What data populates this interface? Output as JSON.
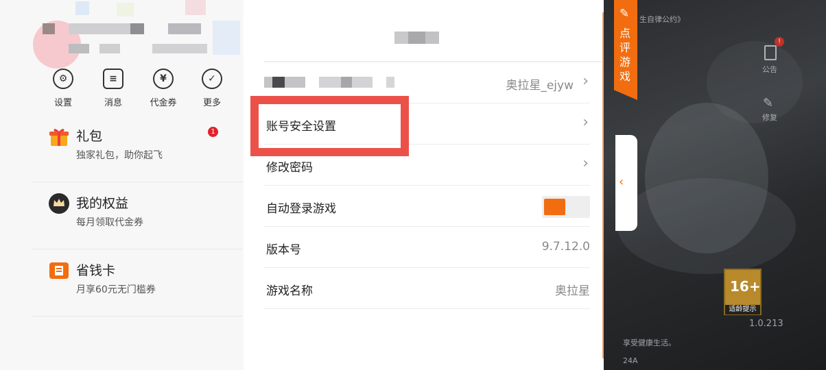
{
  "quick_actions": [
    {
      "label": "设置",
      "icon": "gear-icon",
      "glyph": "⚙"
    },
    {
      "label": "消息",
      "icon": "message-icon",
      "glyph": "≡"
    },
    {
      "label": "代金券",
      "icon": "voucher-icon",
      "glyph": "¥"
    },
    {
      "label": "更多",
      "icon": "more-icon",
      "glyph": "✓"
    }
  ],
  "cards": [
    {
      "title": "礼包",
      "subtitle": "独家礼包，助你起飞",
      "icon": "gift-icon",
      "badge": "1"
    },
    {
      "title": "我的权益",
      "subtitle": "每月领取代金券",
      "icon": "crown-icon"
    },
    {
      "title": "省钱卡",
      "subtitle": "月享60元无门槛券",
      "icon": "savings-card-icon"
    }
  ],
  "settings": {
    "account_value": "奥拉星_ejyw",
    "rows": [
      {
        "label": "账号安全设置"
      },
      {
        "label": "修改密码"
      },
      {
        "label": "自动登录游戏",
        "toggle": true
      },
      {
        "label": "版本号",
        "value": "9.7.12.0"
      },
      {
        "label": "游戏名称",
        "value": "奥拉星"
      }
    ]
  },
  "side": {
    "review_label": "点评游戏"
  },
  "game": {
    "top_text": "生自律公约》",
    "notice_label": "公告",
    "notice_badge": "!",
    "wrench_label": "修复",
    "age_rating": "16+",
    "age_label": "适龄提示",
    "version_fragment": "1.0.213",
    "bottom_text1": "享受健康生活。",
    "bottom_text2": "24A"
  },
  "colors": {
    "accent": "#f26d10",
    "highlight": "#ec5149",
    "badge": "#e0222a"
  }
}
